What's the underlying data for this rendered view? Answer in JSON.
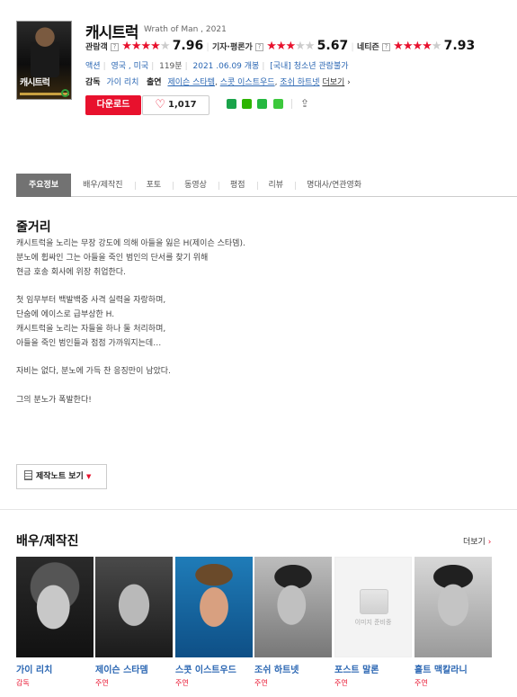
{
  "movie": {
    "title": "캐시트럭",
    "original_title": "Wrath of Man , 2021",
    "poster_title": "캐시트럭"
  },
  "ratings": [
    {
      "label": "관람객",
      "stars_on": 4,
      "stars_off": 1,
      "value": "7.96"
    },
    {
      "label": "기자·평론가",
      "stars_on": 3,
      "stars_off": 2,
      "value": "5.67"
    },
    {
      "label": "네티즌",
      "stars_on": 4,
      "stars_off": 1,
      "value": "7.93"
    }
  ],
  "help_icon_text": "?",
  "meta": {
    "genre": "액션",
    "country": "영국 , 미국",
    "runtime": "119분",
    "release": "2021 .06.09 개봉",
    "grade_region": "[국내]",
    "grade": "청소년 관람불가"
  },
  "credits": {
    "director_label": "감독",
    "director": "가이 리치",
    "cast_label": "출연",
    "cast": [
      "제이슨 스타템",
      "스콧 이스트우드",
      "조쉬 하트넷"
    ],
    "more": "더보기"
  },
  "actions": {
    "download": "다운로드",
    "like_count": "1,017"
  },
  "tabs": [
    "주요정보",
    "배우/제작진",
    "포토",
    "동영상",
    "평점",
    "리뷰",
    "명대사/연관영화"
  ],
  "synopsis": {
    "title": "줄거리",
    "lines": [
      "캐시트럭을 노리는 무장 강도에 의해 아들을 잃은 H(제이슨 스타뎀).",
      "분노에 휩싸인 그는 아들을 죽인 범인의 단서를 찾기 위해",
      "현금 호송 회사에 위장 취업한다.",
      "",
      "첫 임무부터 백발백중 사격 실력을 자랑하며,",
      "단숨에 에이스로 급부상한 H.",
      "캐시트럭을 노리는 자들을 하나 둘 처리하며,",
      "아들을 죽인 범인들과 점점 가까워지는데…",
      "",
      "자비는 없다, 분노에 가득 찬 응징만이 남았다.",
      "",
      "그의 분노가 폭발한다!"
    ],
    "note_button": "제작노트 보기"
  },
  "cast_section": {
    "title": "배우/제작진",
    "more": "더보기",
    "people": [
      {
        "name": "가이 리치",
        "role": "감독"
      },
      {
        "name": "제이슨 스타뎀",
        "role": "주연"
      },
      {
        "name": "스콧 이스트우드",
        "role": "주연"
      },
      {
        "name": "조쉬 하트넷",
        "role": "주연"
      },
      {
        "name": "포스트 말론",
        "role": "주연"
      },
      {
        "name": "홀트 맥칼라니",
        "role": "주연"
      }
    ],
    "no_image_text": "이미지 준비중"
  },
  "colors": {
    "accent_red": "#e8112d",
    "link_blue": "#2b67b3",
    "tab_active": "#727272"
  }
}
